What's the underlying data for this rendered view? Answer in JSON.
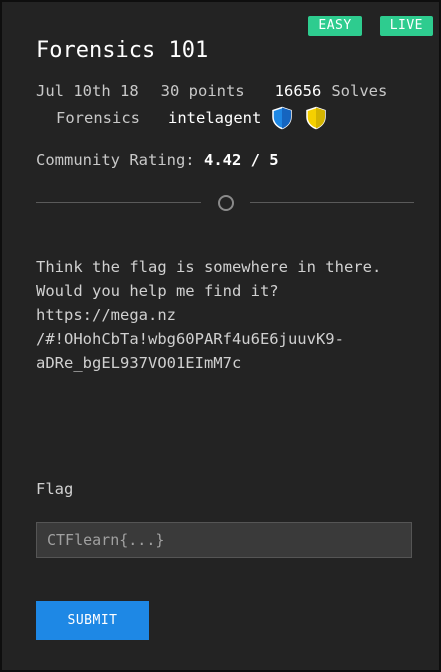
{
  "badges": {
    "difficulty": "EASY",
    "status": "LIVE"
  },
  "challenge": {
    "title": "Forensics 101",
    "date": "Jul 10th 18",
    "points": "30 points",
    "solves_count": "16656",
    "solves_label": "Solves",
    "category": "Forensics",
    "author": "intelagent"
  },
  "rating": {
    "label": "Community Rating:",
    "value": "4.42 / 5"
  },
  "description": {
    "lines": [
      "Think the flag is somewhere in there.",
      "Would you help me find it?",
      "https://mega.nz",
      "/#!OHohCbTa!wbg60PARf4u6E6juuvK9-",
      "aDRe_bgEL937VO01EImM7c"
    ]
  },
  "flag": {
    "label": "Flag",
    "placeholder": "CTFlearn{...}",
    "value": ""
  },
  "submit_label": "SUBMIT",
  "colors": {
    "badge": "#2ecc8f",
    "submit": "#1e88e5",
    "shield_blue": "#1e88e5",
    "shield_yellow": "#f5d000"
  },
  "icons": [
    "shield-blue-icon",
    "shield-yellow-icon"
  ]
}
